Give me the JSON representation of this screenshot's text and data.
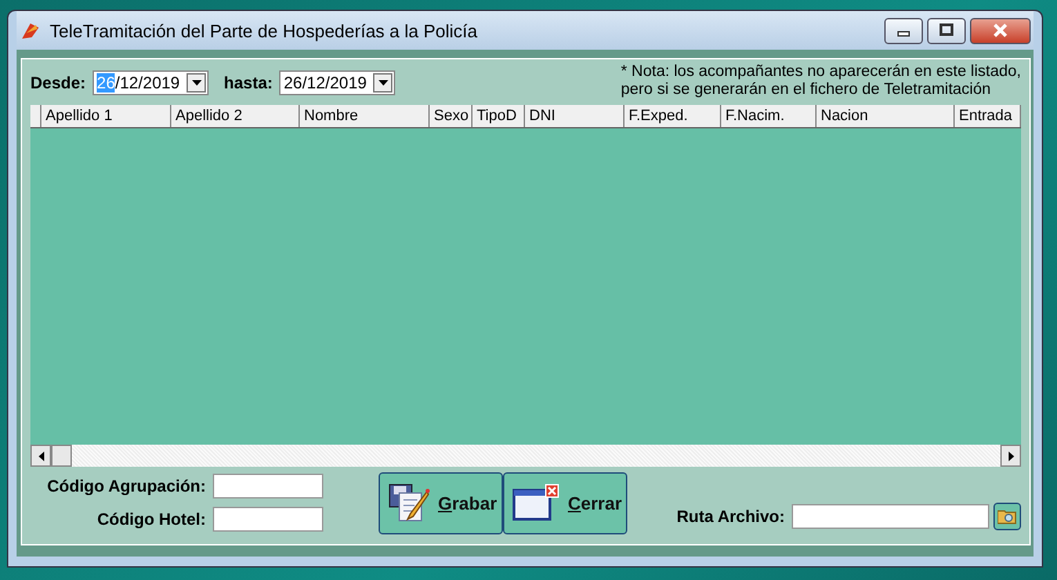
{
  "window": {
    "title": "TeleTramitación del Parte de Hospederías a la Policía"
  },
  "filters": {
    "from_label": "Desde:",
    "from_value": "26/12/2019",
    "to_label": "hasta:",
    "to_value": "26/12/2019"
  },
  "note": [
    "* Nota: los acompañantes no aparecerán en este listado,",
    "pero si se generarán en el fichero de Teletramitación"
  ],
  "table": {
    "columns": [
      {
        "label": "Apellido 1"
      },
      {
        "label": "Apellido 2"
      },
      {
        "label": "Nombre"
      },
      {
        "label": "Sexo"
      },
      {
        "label": "TipoD"
      },
      {
        "label": "DNI"
      },
      {
        "label": "F.Exped."
      },
      {
        "label": "F.Nacim."
      },
      {
        "label": "Nacion"
      },
      {
        "label": "Entrada"
      }
    ]
  },
  "fields": [
    {
      "label": "Código Agrupación:"
    },
    {
      "label": "Código Hotel:"
    }
  ],
  "buttons": [
    {
      "label": "Grabar",
      "kind": "save"
    },
    {
      "label": "Cerrar",
      "kind": "close"
    }
  ],
  "path": {
    "label": "Ruta Archivo:"
  }
}
